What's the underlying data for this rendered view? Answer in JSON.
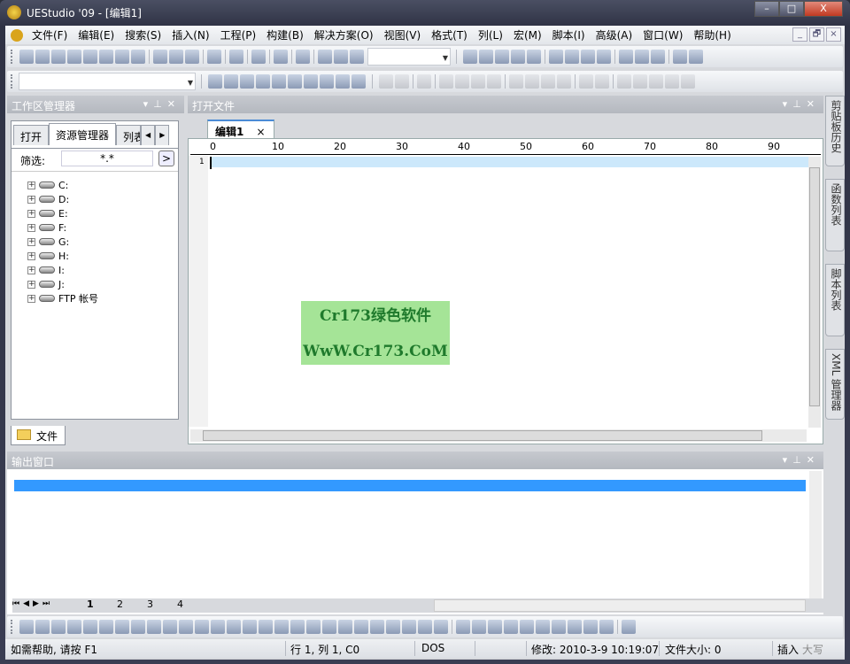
{
  "window": {
    "title": "UEStudio '09 - [编辑1]",
    "min": "–",
    "max": "□",
    "close": "X"
  },
  "menu": [
    "文件(F)",
    "编辑(E)",
    "搜索(S)",
    "插入(N)",
    "工程(P)",
    "构建(B)",
    "解决方案(O)",
    "视图(V)",
    "格式(T)",
    "列(L)",
    "宏(M)",
    "脚本(I)",
    "高级(A)",
    "窗口(W)",
    "帮助(H)"
  ],
  "mdi_buttons": [
    "_",
    "🗗",
    "×"
  ],
  "toolbar1_icons": [
    "project-icon",
    "back-icon",
    "forward-icon",
    "new-file-icon",
    "open-icon",
    "open-folder-icon",
    "save-icon",
    "save-all-icon",
    "|",
    "print-icon",
    "print-preview-icon",
    "font-icon",
    "|",
    "document-icon",
    "|",
    "wrap-icon",
    "|",
    "hex-icon",
    "|",
    "book-icon",
    "|",
    "ftp-icon",
    "|",
    "cut-icon",
    "copy-icon",
    "paste-icon"
  ],
  "toolbar1b_icons": [
    "find-icon",
    "find-prev-icon",
    "find-next-icon",
    "replace-icon",
    "goto-icon",
    "|",
    "align-left-icon",
    "align-center-icon",
    "align-right-icon",
    "justify-icon",
    "|",
    "split-horizontal-icon",
    "split-vertical-icon",
    "cascade-icon",
    "|",
    "globe-icon",
    "browser-icon"
  ],
  "toolbar2_icons": [
    "google-icon",
    "yahoo-icon",
    "wikipedia-icon",
    "msdn-icon",
    "tip-icon",
    "sun-icon",
    "n-icon",
    "php-icon",
    "link-icon",
    "windows-icon"
  ],
  "toolbar2b_icons": [
    "template-icon",
    "php-tool-icon",
    "|",
    "diff-icon",
    "|",
    "comment-icon",
    "uncomment-icon",
    "block-icon",
    "block2-icon",
    "|",
    "indent-icon",
    "outdent-icon",
    "bracket-icon",
    "tab-icon",
    "|",
    "hand-icon",
    "stop-icon",
    "|",
    "layers-icon",
    "list-icon",
    "form-icon",
    "field-icon",
    "binary-icon"
  ],
  "workspace": {
    "title": "工作区管理器",
    "tabs": [
      "打开",
      "资源管理器",
      "列表"
    ],
    "filter_label": "筛选:",
    "filter_value": "*.*",
    "go": ">",
    "tree": [
      "C:",
      "D:",
      "E:",
      "F:",
      "G:",
      "H:",
      "I:",
      "J:",
      "FTP 帐号"
    ],
    "bottom_tab": "文件"
  },
  "editor": {
    "title": "打开文件",
    "tab": "编辑1",
    "tab_close": "×",
    "ruler": [
      "0",
      "10",
      "20",
      "30",
      "40",
      "50",
      "60",
      "70",
      "80",
      "90"
    ],
    "line_number": "1"
  },
  "side_tabs": [
    "剪贴板历史",
    "函数列表",
    "脚本列表",
    "XML 管理器"
  ],
  "output": {
    "title": "输出窗口"
  },
  "sheet_tabs": [
    "1",
    "2",
    "3",
    "4"
  ],
  "format_toolbar_icons": [
    "bold-icon",
    "italic-icon",
    "underline-icon",
    "indent-icon",
    "bullets-icon",
    "numbering-icon",
    "font-color-icon",
    "highlight-icon",
    "h1-icon",
    "h2-icon",
    "h3-icon",
    "h4-icon",
    "form-icon",
    "hr-icon",
    "textbox-icon",
    "textarea-icon",
    "password-icon",
    "button-icon",
    "checkbox-icon",
    "radio-icon",
    "image-icon",
    "image-map-icon",
    "anchor-icon",
    "tag-icon",
    "entity-icon",
    "spell-icon",
    "lock-icon",
    "|",
    "table-icon",
    "copy-icon",
    "validate-icon",
    "id-icon",
    "numbers-icon",
    "tools-icon",
    "css-icon",
    "color-icon",
    "disabled-icon",
    "check-icon",
    "|",
    "panel-icon"
  ],
  "status": {
    "help": "如需帮助, 请按 F1",
    "position": "行 1, 列 1, C0",
    "format": "DOS",
    "modified": "修改: 2010-3-9 10:19:07",
    "size": "文件大小: 0",
    "insert": "插入",
    "caps": "大写"
  },
  "watermark": {
    "line1": "Cr173绿色软件",
    "line2": "WwW.Cr173.CoM"
  }
}
